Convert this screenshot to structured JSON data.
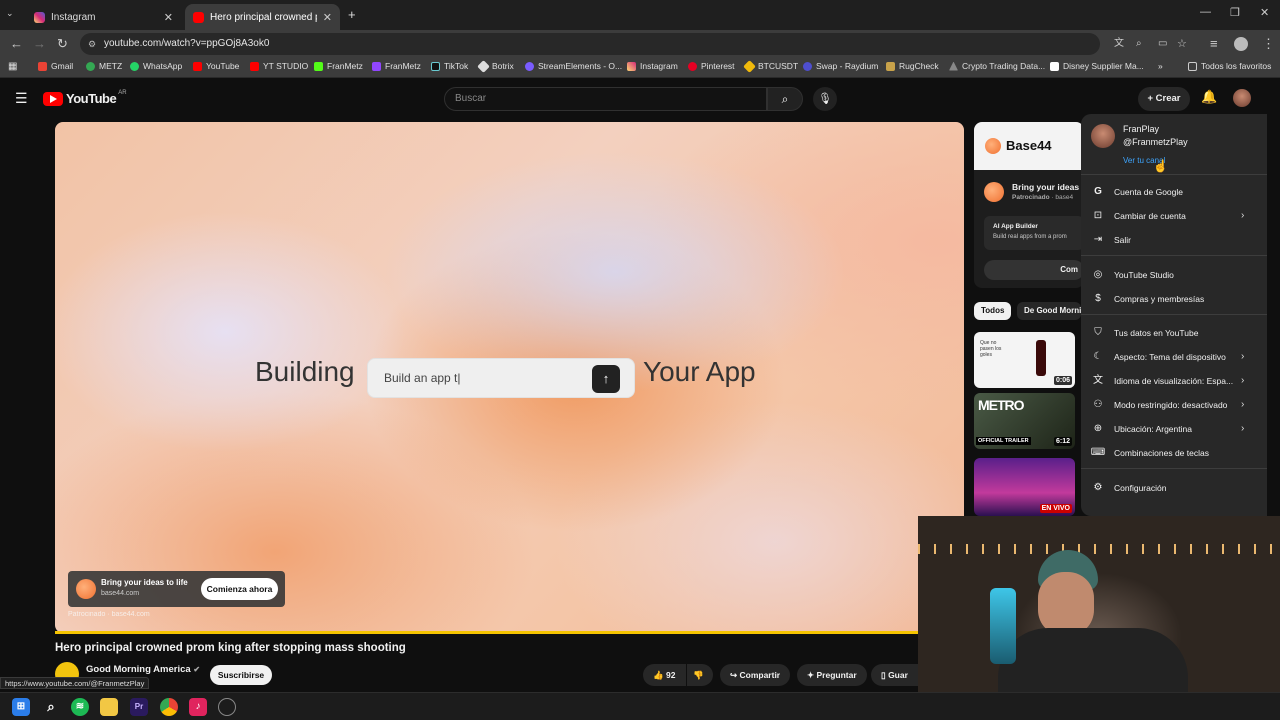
{
  "browser": {
    "tabs": [
      {
        "title": "Instagram",
        "active": false
      },
      {
        "title": "Hero principal crowned prom k",
        "active": true
      }
    ],
    "url": "youtube.com/watch?v=ppGOj8A3ok0",
    "bookmarks": [
      "Gmail",
      "METZ",
      "WhatsApp",
      "YouTube",
      "YT STUDIO",
      "FranMetz",
      "FranMetz",
      "TikTok",
      "Botrix",
      "StreamElements - O...",
      "Instagram",
      "Pinterest",
      "BTCUSDT",
      "Swap - Raydium",
      "RugCheck",
      "Crypto Trading Data...",
      "Disney Supplier Ma..."
    ],
    "all_bookmarks": "Todos los favoritos",
    "status_url": "https://www.youtube.com/@FranmetzPlay"
  },
  "youtube": {
    "logo": "YouTube",
    "region": "AR",
    "search_placeholder": "Buscar",
    "create_label": "Crear"
  },
  "video": {
    "overlay_left": "Building",
    "overlay_right": "Your App",
    "prompt_text": "Build an app t|",
    "ad_title": "Bring your ideas to life",
    "ad_url": "base44.com",
    "ad_cta": "Comienza ahora",
    "sponsored": "Patrocinado",
    "sponsored_url": "base44.com",
    "progress_fraction": 0.95,
    "title": "Hero principal crowned prom king after stopping mass shooting",
    "channel": "Good Morning America",
    "subscribe": "Suscribirse",
    "likes": "92",
    "share": "Compartir",
    "ask": "Preguntar",
    "save": "Guar"
  },
  "side_ad": {
    "brand": "Base44",
    "title": "Bring your ideas",
    "sponsored": "Patrocinado",
    "source": "base4",
    "product": "AI App Builder",
    "desc": "Build real apps from a prom",
    "cta": "Com"
  },
  "filters": [
    "Todos",
    "De Good Morni"
  ],
  "related": [
    {
      "duration": "0:06",
      "caption": "Que no pasen los goles"
    },
    {
      "duration": "6:12",
      "label": "METRO",
      "sub": "OFFICIAL TRAILER"
    },
    {
      "live": "EN VIVO"
    }
  ],
  "account_menu": {
    "name": "FranPlay",
    "handle": "@FranmetzPlay",
    "view_channel": "Ver tu canal",
    "items": [
      {
        "label": "Cuenta de Google",
        "icon": "google-icon",
        "chevron": false
      },
      {
        "label": "Cambiar de cuenta",
        "icon": "switch-account-icon",
        "chevron": true
      },
      {
        "label": "Salir",
        "icon": "sign-out-icon",
        "chevron": false
      },
      {
        "label": "YouTube Studio",
        "icon": "studio-icon",
        "chevron": false
      },
      {
        "label": "Compras y membresías",
        "icon": "dollar-icon",
        "chevron": false
      },
      {
        "label": "Tus datos en YouTube",
        "icon": "shield-icon",
        "chevron": false
      },
      {
        "label": "Aspecto: Tema del dispositivo",
        "icon": "moon-icon",
        "chevron": true
      },
      {
        "label": "Idioma de visualización: Espa...",
        "icon": "translate-icon",
        "chevron": true
      },
      {
        "label": "Modo restringido: desactivado",
        "icon": "restricted-icon",
        "chevron": true
      },
      {
        "label": "Ubicación: Argentina",
        "icon": "globe-icon",
        "chevron": true
      },
      {
        "label": "Combinaciones de teclas",
        "icon": "keyboard-icon",
        "chevron": false
      },
      {
        "label": "Configuración",
        "icon": "gear-icon",
        "chevron": false
      }
    ]
  },
  "colors": {
    "yt_red": "#ff0000",
    "link_blue": "#3ea6ff",
    "ad_orange": "#f07030"
  }
}
